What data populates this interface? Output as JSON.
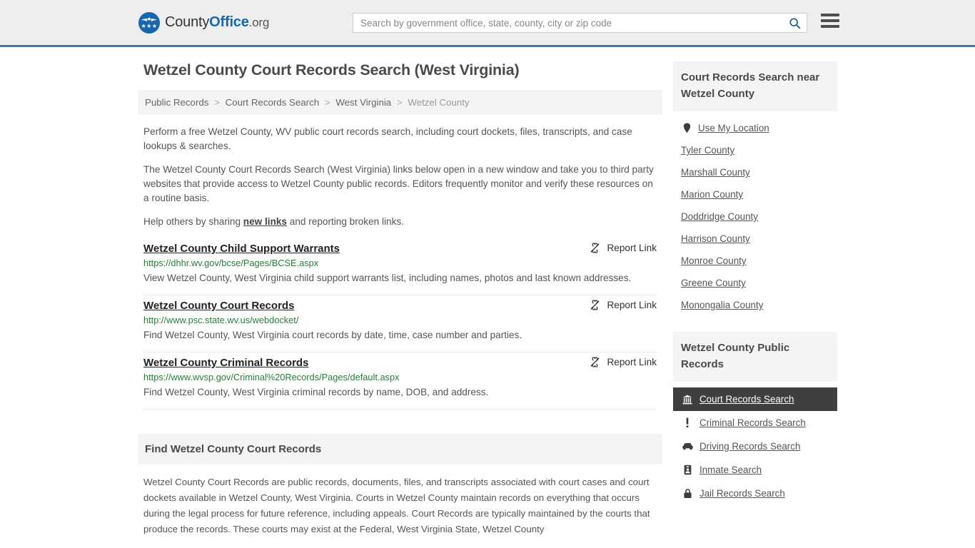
{
  "header": {
    "logo": {
      "part1": "County",
      "part2": "Office",
      "part3": ".org",
      "stars": "★★★"
    },
    "search": {
      "placeholder": "Search by government office, state, county, city or zip code",
      "value": ""
    },
    "accent_color": "#3b7ab0",
    "logo_color": "#1666b0"
  },
  "page": {
    "title": "Wetzel County Court Records Search (West Virginia)"
  },
  "breadcrumb": {
    "items": [
      {
        "label": "Public Records",
        "current": false
      },
      {
        "label": "Court Records Search",
        "current": false
      },
      {
        "label": "West Virginia",
        "current": false
      },
      {
        "label": "Wetzel County",
        "current": true
      }
    ],
    "separator": ">"
  },
  "intro": {
    "p1": "Perform a free Wetzel County, WV public court records search, including court dockets, files, transcripts, and case lookups & searches.",
    "p2": "The Wetzel County Court Records Search (West Virginia) links below open in a new window and take you to third party websites that provide access to Wetzel County public records. Editors frequently monitor and verify these resources on a routine basis.",
    "p3_before": "Help others by sharing ",
    "p3_link": "new links",
    "p3_after": " and reporting broken links."
  },
  "report_link_label": "Report Link",
  "links": [
    {
      "title": "Wetzel County Child Support Warrants",
      "url": "https://dhhr.wv.gov/bcse/Pages/BCSE.aspx",
      "description": "View Wetzel County, West Virginia child support warrants list, including names, photos and last known addresses."
    },
    {
      "title": "Wetzel County Court Records",
      "url": "http://www.psc.state.wv.us/webdocket/",
      "description": "Find Wetzel County, West Virginia court records by date, time, case number and parties."
    },
    {
      "title": "Wetzel County Criminal Records",
      "url": "https://www.wvsp.gov/Criminal%20Records/Pages/default.aspx",
      "description": "Find Wetzel County, West Virginia criminal records by name, DOB, and address."
    }
  ],
  "find_section": {
    "heading": "Find Wetzel County Court Records",
    "body": "Wetzel County Court Records are public records, documents, files, and transcripts associated with court cases and court dockets available in Wetzel County, West Virginia. Courts in Wetzel County maintain records on everything that occurs during the legal process for future reference, including appeals. Court Records are typically maintained by the courts that produce the records. These courts may exist at the Federal, West Virginia State, Wetzel County"
  },
  "sidebar": {
    "nearby": {
      "heading": "Court Records Search near Wetzel County",
      "use_my_location": {
        "label": "Use My Location",
        "icon": "map-pin-icon"
      },
      "counties": [
        "Tyler County",
        "Marshall County",
        "Marion County",
        "Doddridge County",
        "Harrison County",
        "Monroe County",
        "Greene County",
        "Monongalia County"
      ]
    },
    "public_records": {
      "heading": "Wetzel County Public Records",
      "active_bg": "#3f3f3f",
      "items": [
        {
          "label": "Court Records Search",
          "icon": "courthouse-icon",
          "active": true
        },
        {
          "label": "Criminal Records Search",
          "icon": "exclamation-icon",
          "active": false
        },
        {
          "label": "Driving Records Search",
          "icon": "car-icon",
          "active": false
        },
        {
          "label": "Inmate Search",
          "icon": "id-badge-icon",
          "active": false
        },
        {
          "label": "Jail Records Search",
          "icon": "lock-icon",
          "active": false
        }
      ]
    }
  }
}
